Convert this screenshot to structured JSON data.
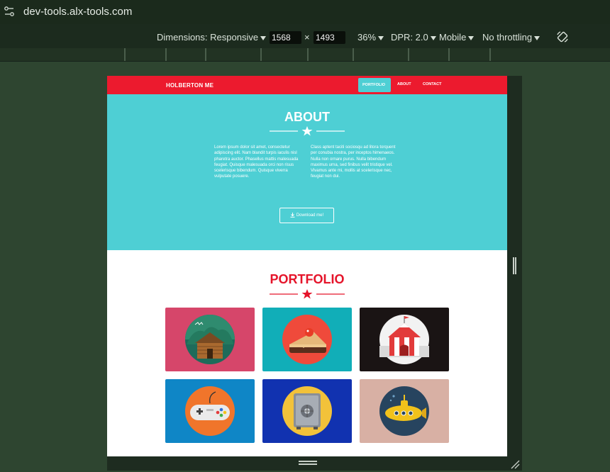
{
  "browser": {
    "url": "dev-tools.alx-tools.com"
  },
  "devtools": {
    "dimensions_label": "Dimensions: Responsive",
    "width": "1568",
    "times": "×",
    "height": "1493",
    "zoom": "36%",
    "dpr": "DPR: 2.0",
    "device": "Mobile",
    "throttling": "No throttling"
  },
  "site": {
    "brand": "HOLBERTON ME",
    "nav": [
      "PORTFOLIO",
      "ABOUT",
      "CONTACT"
    ],
    "about": {
      "title": "ABOUT",
      "col1": "Lorem ipsum dolor sit amet, consectetur adipiscing elit. Nam blandit turpis iaculis nisl pharetra auctor. Phasellus mattis malesuada feugiat. Quisque malesuada orci non risus scelerisque bibendum. Quisque viverra vulputate posuere.",
      "col2": "Class aptent taciti sociosqu ad litora torquent per conubia nostra, per inceptos himenaeos. Nulla non ornare purus. Nulla bibendum maximus urna, sed finibus velit tristique vel. Vivamus ante mi, mollis at scelerisque nec, feugiat non dui.",
      "button": "Download me!",
      "button_icon": "download-icon"
    },
    "portfolio": {
      "title": "PORTFOLIO",
      "tiles": [
        {
          "icon": "cabin-icon",
          "bg": "#d6466a"
        },
        {
          "icon": "cake-icon",
          "bg": "#11aeb8"
        },
        {
          "icon": "circus-tent-icon",
          "bg": "#1a1414"
        },
        {
          "icon": "game-controller-icon",
          "bg": "#0f86c6"
        },
        {
          "icon": "safe-icon",
          "bg": "#1132b0"
        },
        {
          "icon": "submarine-icon",
          "bg": "#d8b0a4"
        }
      ]
    }
  },
  "colors": {
    "nav_red": "#ec1a2e",
    "teal": "#4ecfd4",
    "portfolio_red": "#e5142a"
  }
}
